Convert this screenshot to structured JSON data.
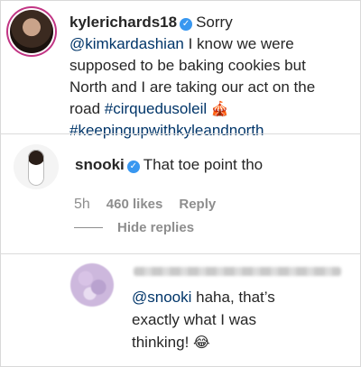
{
  "comments": [
    {
      "username": "kylerichards18",
      "verified_glyph": "✓",
      "text_lines": [
        "Sorry",
        "@kimkardashian I know we were",
        "supposed to be baking cookies but",
        "North and I are taking our act on the",
        "road #cirquedusoleil 🎪",
        "#keepingupwithkyleandnorth"
      ],
      "mention": "@kimkardashian",
      "line1_rest": " I know we were",
      "line2": "supposed to be baking cookies but",
      "line3": "North and I are taking our act on the",
      "line4_prefix": "road ",
      "hashtag1": "#cirquedusoleil",
      "emoji1": "🎪",
      "hashtag2": "#keepingupwithkyleandnorth"
    },
    {
      "username": "snooki",
      "verified_glyph": "✓",
      "text": "That toe point tho",
      "time": "5h",
      "likes": "460 likes",
      "reply": "Reply",
      "hide_replies": "Hide replies"
    },
    {
      "mention": "@snooki",
      "text_line1": " haha, that’s",
      "text_line2": "exactly what I was",
      "text_line3": "thinking! ",
      "emoji": "😂"
    }
  ],
  "icons": [
    "verified-badge-icon",
    "circus-tent-icon",
    "joy-emoji-icon"
  ],
  "colors": {
    "link": "#003569",
    "verified": "#3897f0",
    "muted": "#8e8e8e",
    "text": "#262626",
    "divider": "#dbdbdb"
  }
}
